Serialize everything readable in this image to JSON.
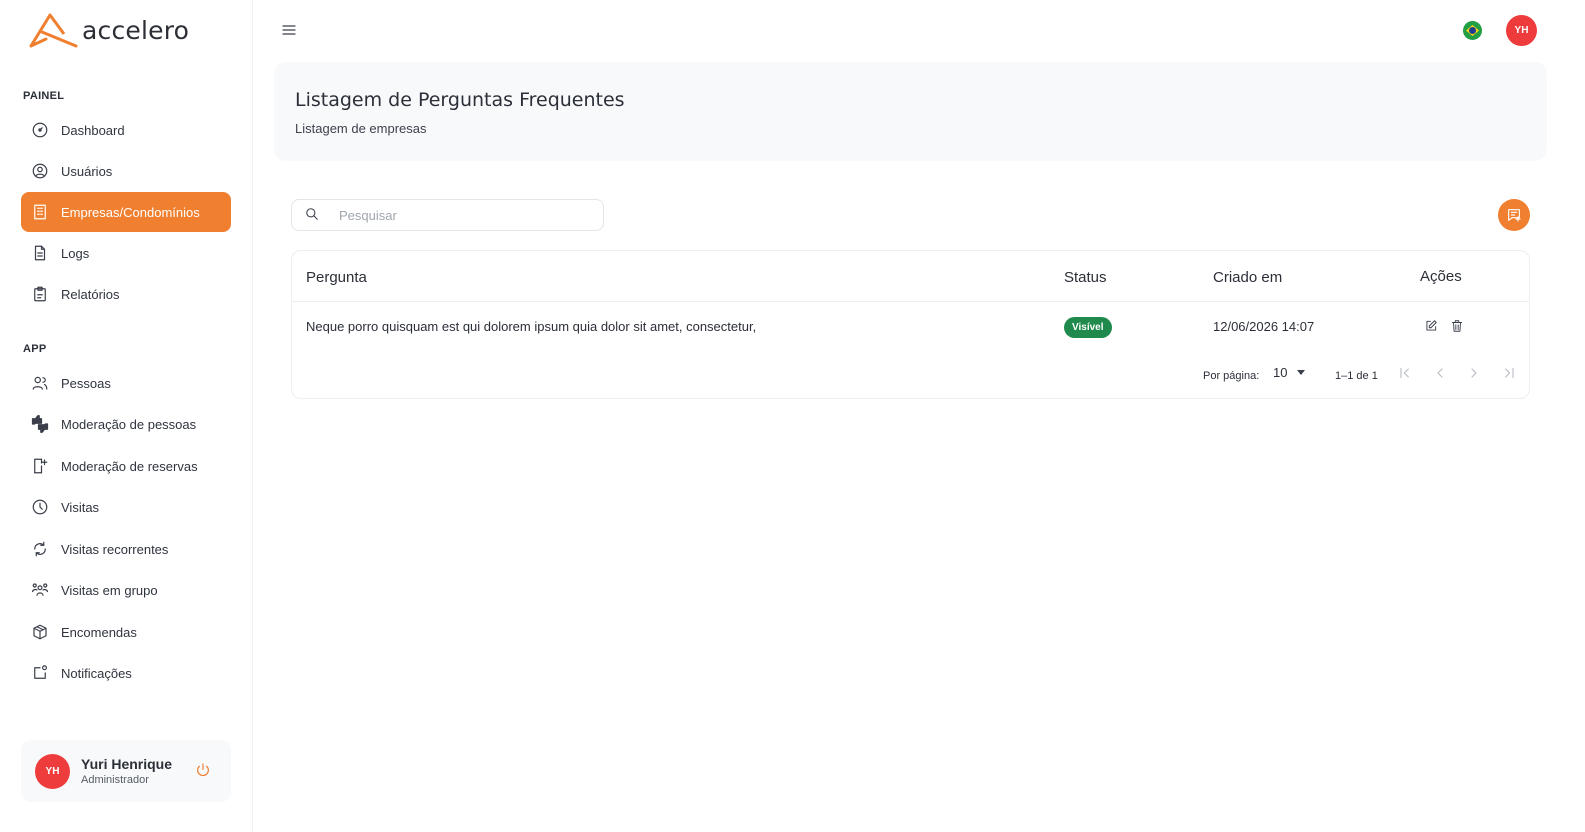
{
  "brand": {
    "name": "accelero",
    "accent": "#f07f30"
  },
  "sidebar": {
    "sections": [
      {
        "label": "PAINEL"
      },
      {
        "label": "APP"
      }
    ],
    "items": [
      {
        "label": "Dashboard",
        "icon": "gauge-icon"
      },
      {
        "label": "Usuários",
        "icon": "user-circle-icon"
      },
      {
        "label": "Empresas/Condomínios",
        "icon": "building-icon",
        "active": true
      },
      {
        "label": "Logs",
        "icon": "file-text-icon"
      },
      {
        "label": "Relatórios",
        "icon": "clipboard-icon"
      },
      {
        "label": "Pessoas",
        "icon": "users-icon"
      },
      {
        "label": "Moderação de pessoas",
        "icon": "thumbs-icon"
      },
      {
        "label": "Moderação de reservas",
        "icon": "door-icon"
      },
      {
        "label": "Visitas",
        "icon": "clock-icon"
      },
      {
        "label": "Visitas recorrentes",
        "icon": "refresh-icon"
      },
      {
        "label": "Visitas em grupo",
        "icon": "group-icon"
      },
      {
        "label": "Encomendas",
        "icon": "package-icon"
      },
      {
        "label": "Notificações",
        "icon": "notification-icon"
      }
    ]
  },
  "user": {
    "initials": "YH",
    "name": "Yuri Henrique",
    "role": "Administrador",
    "avatar_color": "#ee3b3b"
  },
  "header": {
    "title": "Listagem de Perguntas Frequentes",
    "subtitle": "Listagem de empresas"
  },
  "search": {
    "placeholder": "Pesquisar",
    "value": ""
  },
  "table": {
    "columns": [
      "Pergunta",
      "Status",
      "Criado em",
      "Ações"
    ],
    "rows": [
      {
        "question": "Neque porro quisquam est qui dolorem ipsum quia dolor sit amet, consectetur,",
        "status": "Visível",
        "status_color": "#1f8a4c",
        "created": "12/06/2026 14:07"
      }
    ],
    "pagination": {
      "per_page_label": "Por página:",
      "per_page": "10",
      "range": "1–1 de 1"
    }
  }
}
